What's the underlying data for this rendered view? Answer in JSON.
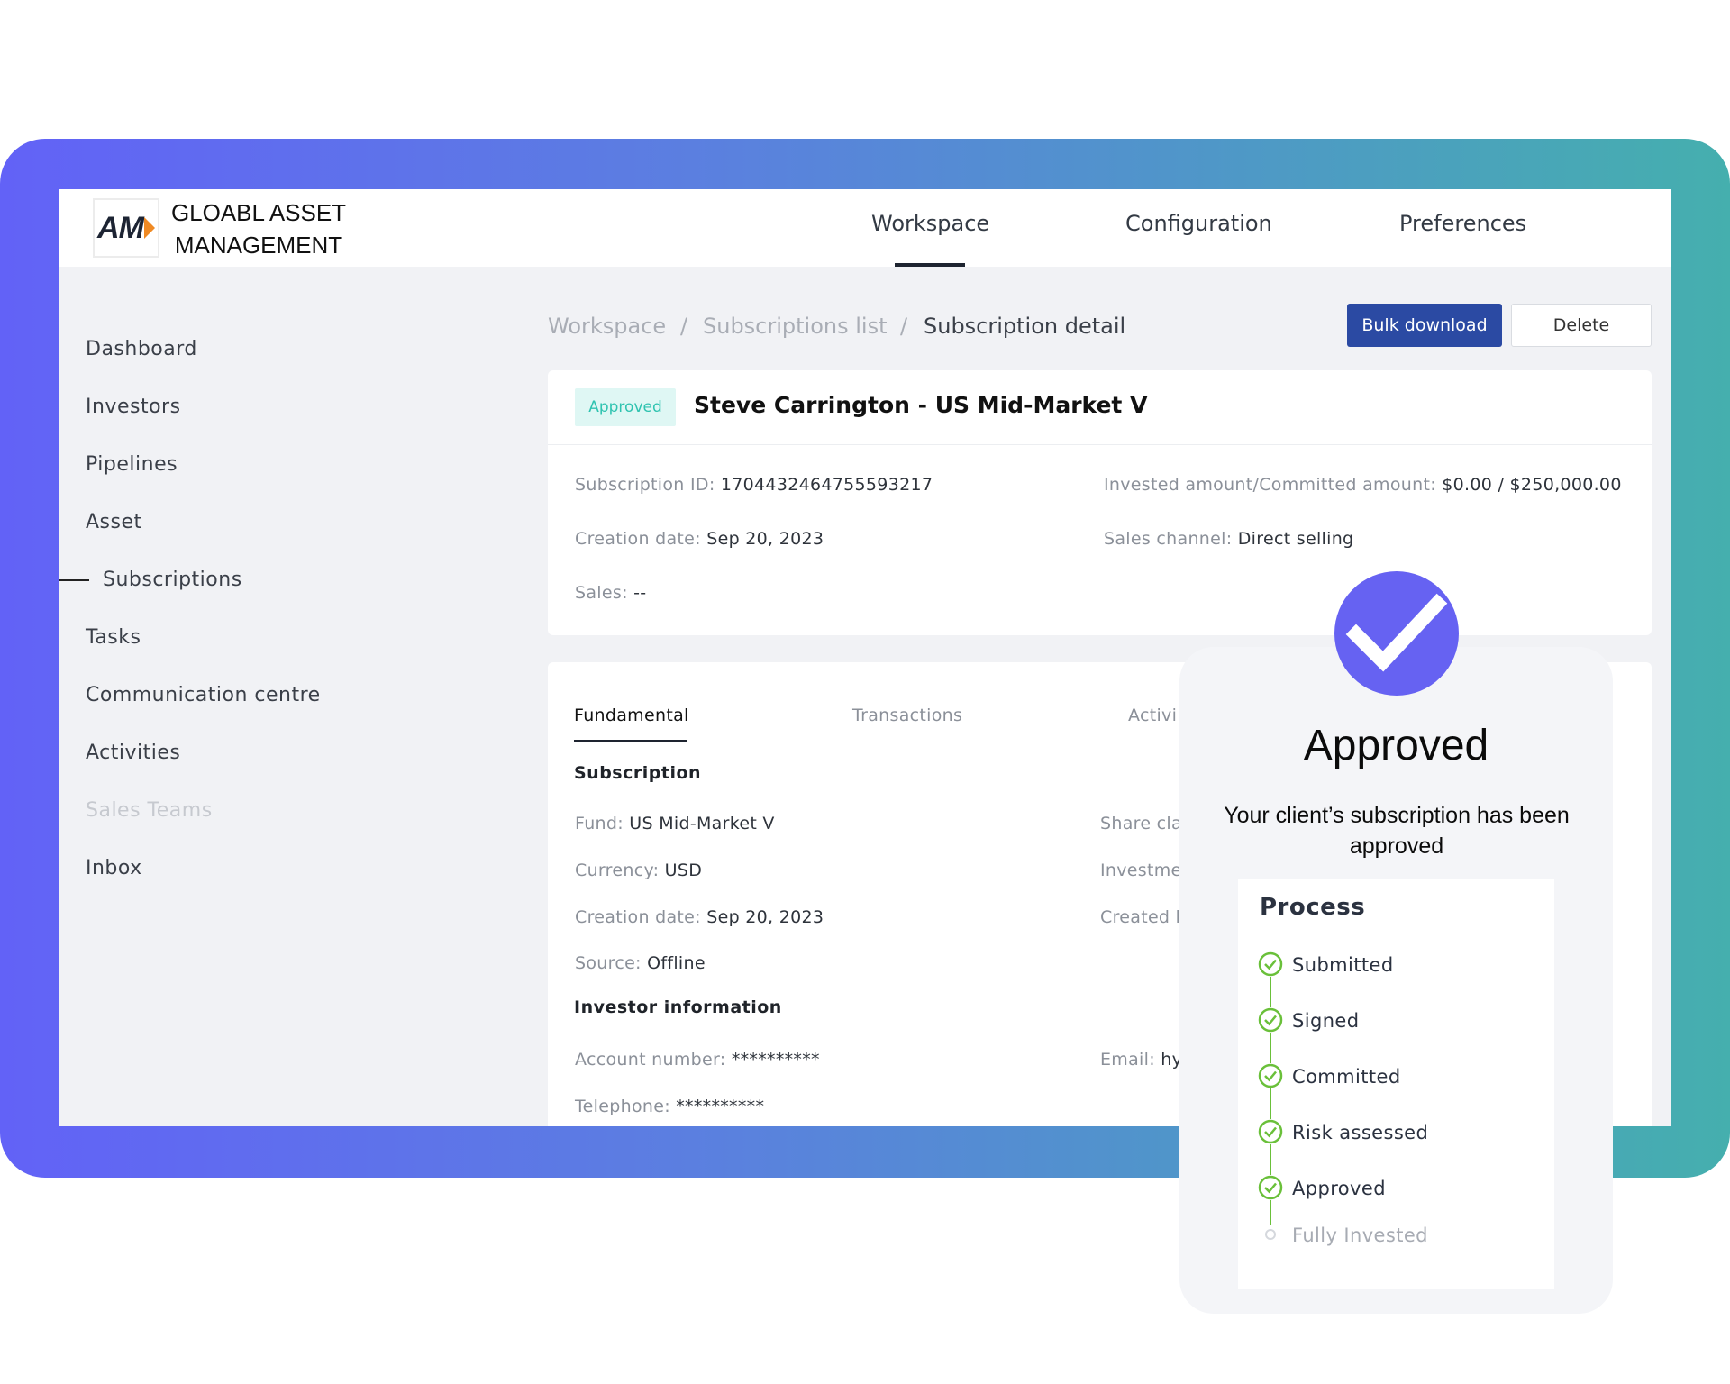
{
  "brand": {
    "logo_text": "AM",
    "name": "GLOABL ASSET MANAGEMENT"
  },
  "nav": [
    {
      "label": "Workspace",
      "active": true
    },
    {
      "label": "Configuration",
      "active": false
    },
    {
      "label": "Preferences",
      "active": false
    }
  ],
  "sidebar": [
    {
      "label": "Dashboard"
    },
    {
      "label": "Investors"
    },
    {
      "label": "Pipelines"
    },
    {
      "label": "Asset"
    },
    {
      "label": "Subscriptions",
      "active": true
    },
    {
      "label": "Tasks"
    },
    {
      "label": "Communication centre"
    },
    {
      "label": "Activities"
    },
    {
      "label": "Sales Teams",
      "disabled": true
    },
    {
      "label": "Inbox"
    }
  ],
  "breadcrumb": {
    "items": [
      "Workspace",
      "Subscriptions list",
      "Subscription detail"
    ],
    "separator": "/"
  },
  "actions": {
    "bulk_download": "Bulk download",
    "delete": "Delete"
  },
  "summary": {
    "status": "Approved",
    "title": "Steve Carrington - US Mid-Market V",
    "fields": [
      {
        "key": "Subscription ID:",
        "value": "1704432464755593217"
      },
      {
        "key": "Invested amount/Committed amount:",
        "value": "$0.00 / $250,000.00"
      },
      {
        "key": "Creation date:",
        "value": "Sep 20, 2023"
      },
      {
        "key": "Sales channel:",
        "value": "Direct selling"
      },
      {
        "key": "Sales:",
        "value": "--"
      }
    ]
  },
  "tabs": [
    {
      "label": "Fundamental",
      "active": true
    },
    {
      "label": "Transactions"
    },
    {
      "label": "Activi"
    }
  ],
  "subscription_section": {
    "title": "Subscription",
    "left": [
      {
        "key": "Fund:",
        "value": "US Mid-Market V"
      },
      {
        "key": "Currency:",
        "value": "USD"
      },
      {
        "key": "Creation date:",
        "value": "Sep 20, 2023"
      },
      {
        "key": "Source:",
        "value": "Offline"
      }
    ],
    "right": [
      {
        "key": "Share cla"
      },
      {
        "key": "Investme"
      },
      {
        "key": "Created b"
      }
    ]
  },
  "investor_section": {
    "title": "Investor information",
    "left": [
      {
        "key": "Account number:",
        "value": "**********"
      },
      {
        "key": "Telephone:",
        "value": "**********"
      }
    ],
    "right": [
      {
        "key": "Email:",
        "value": "hy"
      }
    ]
  },
  "approval": {
    "title": "Approved",
    "message": "Your client’s subscription has been approved",
    "accent_color": "#6662f2",
    "process": {
      "title": "Process",
      "steps": [
        {
          "label": "Submitted",
          "done": true
        },
        {
          "label": "Signed",
          "done": true
        },
        {
          "label": "Committed",
          "done": true
        },
        {
          "label": "Risk assessed",
          "done": true
        },
        {
          "label": "Approved",
          "done": true
        },
        {
          "label": "Fully Invested",
          "done": false
        }
      ]
    }
  }
}
